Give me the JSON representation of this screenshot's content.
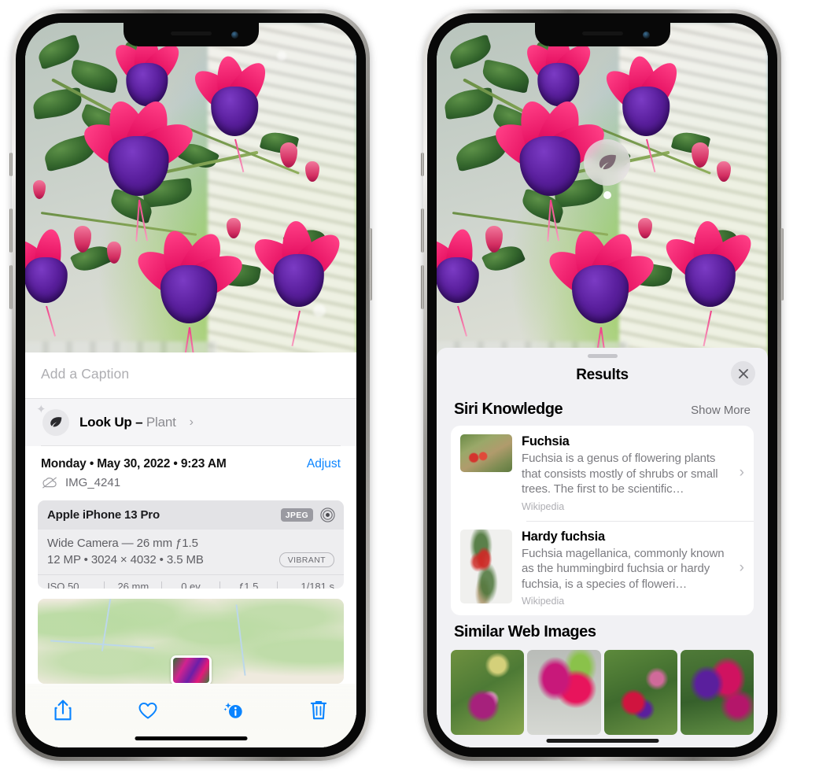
{
  "left_phone": {
    "caption": {
      "placeholder": "Add a Caption",
      "value": ""
    },
    "lookup": {
      "label": "Look Up",
      "dash": " – ",
      "subject": "Plant",
      "chevron": "›",
      "icon": "leaf-icon"
    },
    "date_row": {
      "date": "Monday • May 30, 2022 • 9:23 AM",
      "adjust_label": "Adjust"
    },
    "file_row": {
      "name": "IMG_4241",
      "icon": "icloud-slash-icon"
    },
    "metadata": {
      "device": "Apple iPhone 13 Pro",
      "format_badge": "JPEG",
      "lens_line": "Wide Camera — 26 mm ƒ1.5",
      "specs_line": "12 MP • 3024 × 4032 • 3.5 MB",
      "style_badge": "VIBRANT",
      "exif": [
        "ISO 50",
        "26 mm",
        "0 ev",
        "ƒ1.5",
        "1/181 s"
      ]
    },
    "toolbar": [
      {
        "name": "share-button",
        "icon": "share-icon"
      },
      {
        "name": "favorite-button",
        "icon": "heart-icon"
      },
      {
        "name": "info-button",
        "icon": "info-sparkle-icon"
      },
      {
        "name": "delete-button",
        "icon": "trash-icon"
      }
    ],
    "accent_color": "#0a84ff"
  },
  "right_phone": {
    "badge": {
      "icon": "leaf-icon"
    },
    "sheet": {
      "title": "Results",
      "close_icon": "close-icon",
      "siri_section": {
        "title": "Siri Knowledge",
        "show_more": "Show More"
      },
      "knowledge_items": [
        {
          "title": "Fuchsia",
          "description": "Fuchsia is a genus of flowering plants that consists mostly of shrubs or small trees. The first to be scientific…",
          "source": "Wikipedia",
          "chevron": "›"
        },
        {
          "title": "Hardy fuchsia",
          "description": "Fuchsia magellanica, commonly known as the hummingbird fuchsia or hardy fuchsia, is a species of floweri…",
          "source": "Wikipedia",
          "chevron": "›"
        }
      ],
      "web_section": {
        "title": "Similar Web Images"
      },
      "web_images": [
        "web-image-1",
        "web-image-2",
        "web-image-3",
        "web-image-4"
      ]
    }
  }
}
